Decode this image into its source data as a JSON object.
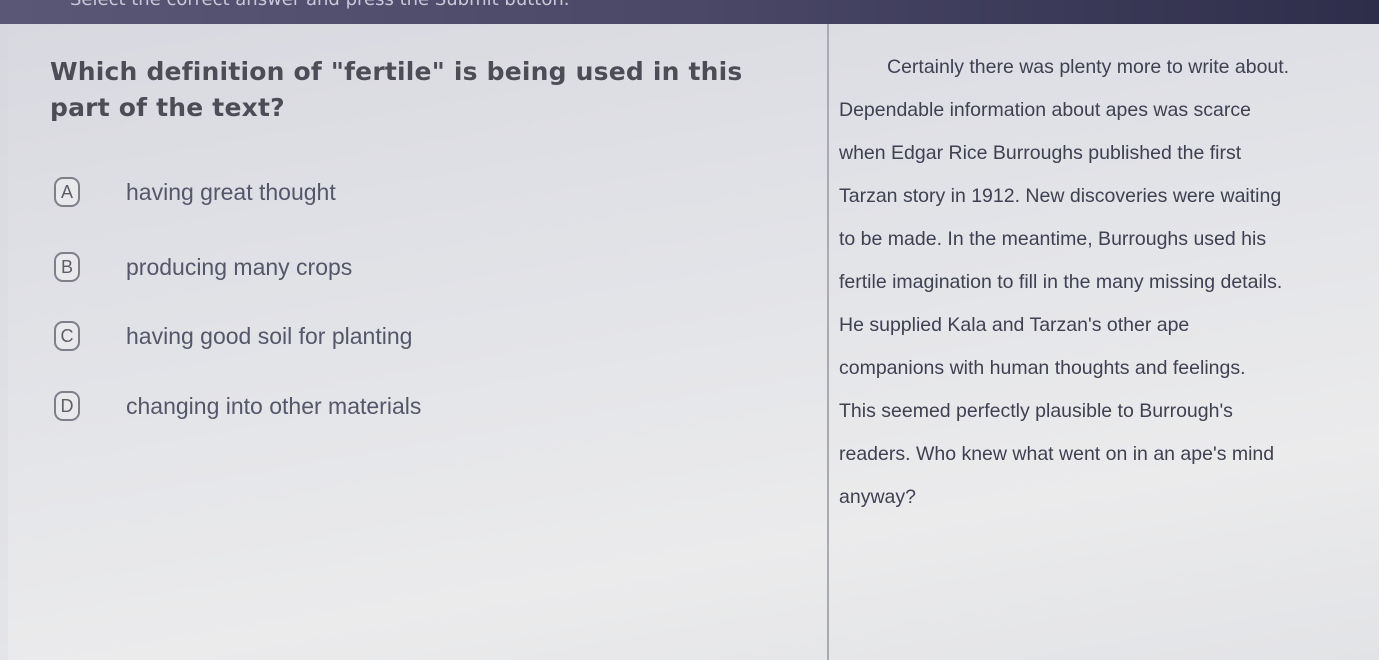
{
  "header": {
    "instruction": "Select the correct answer and press the Submit button."
  },
  "question": {
    "text": "Which definition of \"fertile\" is being used in this part of the text?"
  },
  "options": [
    {
      "letter": "A",
      "label": "having great thought"
    },
    {
      "letter": "B",
      "label": "producing many crops"
    },
    {
      "letter": "C",
      "label": "having good soil for planting"
    },
    {
      "letter": "D",
      "label": "changing into other materials"
    }
  ],
  "passage": {
    "lines": [
      "Certainly there was plenty more to write about.",
      "Dependable information about apes was scarce",
      "when Edgar Rice Burroughs published the first",
      "Tarzan story in 1912. New discoveries were waiting",
      "to be made. In the meantime, Burroughs used his",
      "fertile imagination to fill in the many missing details.",
      "He supplied Kala and Tarzan's other ape",
      "companions with human thoughts and feelings.",
      "This seemed perfectly plausible to Burrough's",
      "readers. Who knew what went on in an ape's mind",
      "anyway?"
    ]
  }
}
